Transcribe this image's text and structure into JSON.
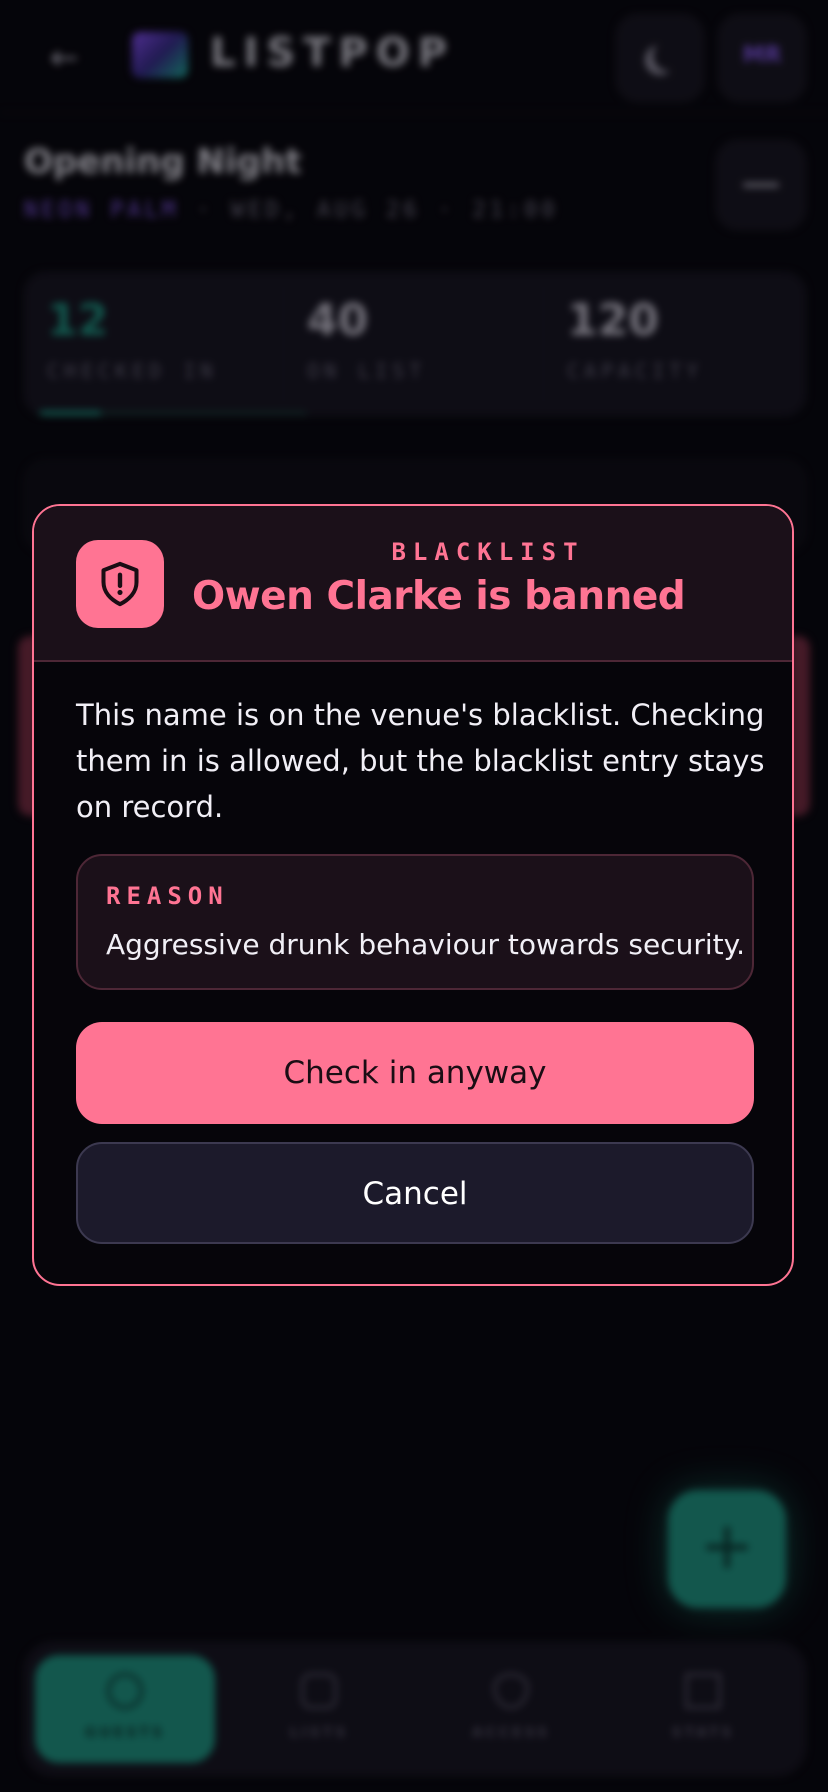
{
  "header": {
    "brand": "LISTPOP",
    "avatar_initials": "MR"
  },
  "event": {
    "title": "Opening Night",
    "venue": "NEON PALM",
    "when": "· WED, AUG 26 · 21:00"
  },
  "stats": [
    {
      "value": "12",
      "label": "CHECKED IN"
    },
    {
      "value": "40",
      "label": "ON LIST"
    },
    {
      "value": "120",
      "label": "CAPACITY"
    }
  ],
  "progress": {
    "checked_in_fraction": 0.1
  },
  "fab": {
    "icon": "plus-icon",
    "label": "+"
  },
  "tabs": [
    {
      "label": "GUESTS",
      "icon": "user-icon",
      "active": true
    },
    {
      "label": "LISTS",
      "icon": "list-icon",
      "active": false
    },
    {
      "label": "ACCESS",
      "icon": "shield-icon",
      "active": false
    },
    {
      "label": "STATS",
      "icon": "chart-icon",
      "active": false
    }
  ],
  "modal": {
    "kicker": "BLACKLIST",
    "title": "Owen Clarke is banned",
    "body": "This name is on the venue's blacklist. Checking them in is allowed, but the blacklist entry stays on record.",
    "reason_label": "REASON",
    "reason_text": "Aggressive drunk behaviour towards security.",
    "confirm_label": "Check in anyway",
    "cancel_label": "Cancel"
  },
  "colors": {
    "accent_pink": "#ff7493",
    "accent_teal": "#1fb89c",
    "violet": "#8b5cf6",
    "background": "#07060b"
  }
}
